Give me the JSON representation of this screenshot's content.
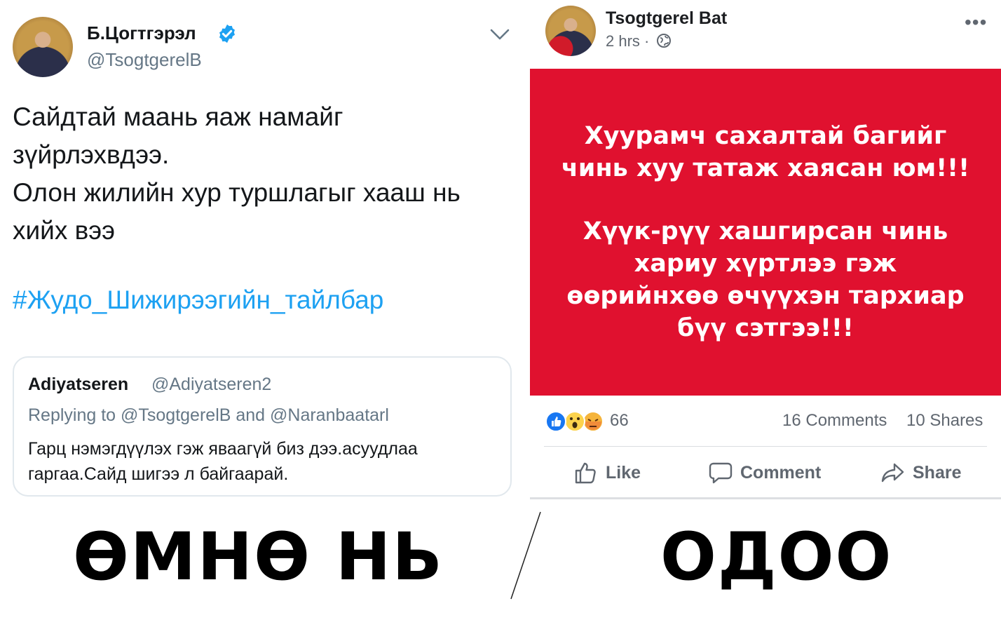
{
  "twitter": {
    "name": "Б.Цогтгэрэл",
    "handle": "@TsogtgerelB",
    "body_lines": [
      "Сайдтай маань яаж намайг",
      "зүйрлэхвдээ.",
      "Олон жилийн хур туршлагыг хааш нь",
      "хийх вээ"
    ],
    "hashtag": "#Жудо_Шижирээгийн_тайлбар",
    "quote": {
      "name": "Adiyatseren",
      "handle": "@Adiyatseren2",
      "replying": "Replying to @TsogtgerelB and @Naranbaatarl",
      "text_lines": [
        "Гарц нэмэгдүүлэх гэж яваагүй биз дээ.асуудлаа",
        "гаргаа.Сайд шигээ л байгаарай."
      ]
    }
  },
  "facebook": {
    "name": "Tsogtgerel Bat",
    "time": "2 hrs ·",
    "more": "•••",
    "banner_lines": [
      "Хуурамч сахалтай багийг",
      "чинь хуу татаж хаясан юм!!!",
      "Хүүк-рүү хашгирсан чинь",
      "хариу хүртлээ гэж",
      "өөрийнхөө өчүүхэн тархиар",
      "бүү сэтгээ!!!"
    ],
    "reaction_count": "66",
    "comments": "16 Comments",
    "shares": "10 Shares",
    "actions": {
      "like": "Like",
      "comment": "Comment",
      "share": "Share"
    },
    "banner_color": "#e0112f"
  },
  "labels": {
    "before": "ӨМНӨ НЬ",
    "now": "ОДОО"
  }
}
